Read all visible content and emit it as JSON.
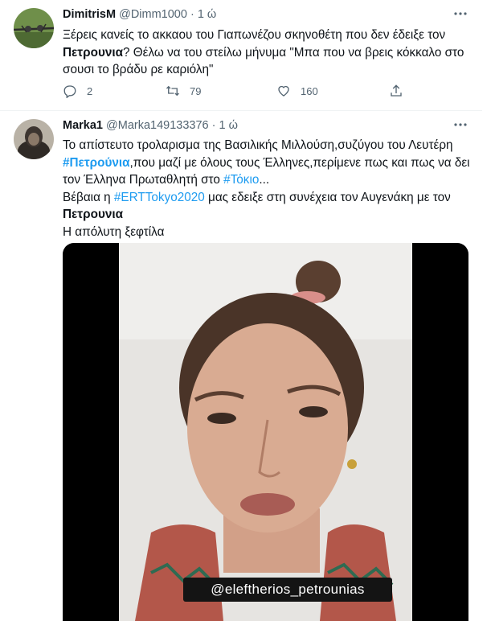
{
  "tweets": [
    {
      "name": "DimitrisM",
      "handle": "@Dimm1000",
      "separator": "·",
      "time": "1 ώ",
      "text": {
        "line1": "Ξέρεις κανείς το ακκαου του Γιαπωνέζου σκηνοθέτη που δεν έδειξε τον",
        "bold": "Πετρουνια",
        "line2_rest": "? Θέλω να του στείλω μήνυμα \"Μπα που να βρεις κόκκαλο στο",
        "line3": "σουσι το βράδυ ρε καριόλη\""
      },
      "replies": "2",
      "retweets": "79",
      "likes": "160"
    },
    {
      "name": "Marka1",
      "handle": "@Marka149133376",
      "separator": "·",
      "time": "1 ώ",
      "text": {
        "line1": "Το απίστευτο τρολαρισμα της Βασιλικής Μιλλούση,συζύγου του Λευτέρη",
        "hashtag1": "#Πετρούνια",
        "line2_rest": ",που μαζί με όλους τους Έλληνες,περίμενε πως και πως να δει",
        "line3_pre": "τον Έλληνα Πρωταθλητή στο ",
        "hashtag2": "#Τόκιο",
        "line3_post": "...",
        "line4_pre": "Βέβαια η ",
        "hashtag3": "#ERTTokyo2020",
        "line4_post": " μας εδειξε στη συνέχεια τον Αυγενάκη με τον",
        "bold": "Πετρουνια",
        "line6": "Η απόλυτη ξεφτίλα"
      },
      "video_caption": "@eleftherios_petrounias"
    }
  ],
  "more_icon": "more-icon",
  "colors": {
    "link": "#1d9bf0",
    "secondary": "#536471",
    "text": "#0f1419"
  }
}
